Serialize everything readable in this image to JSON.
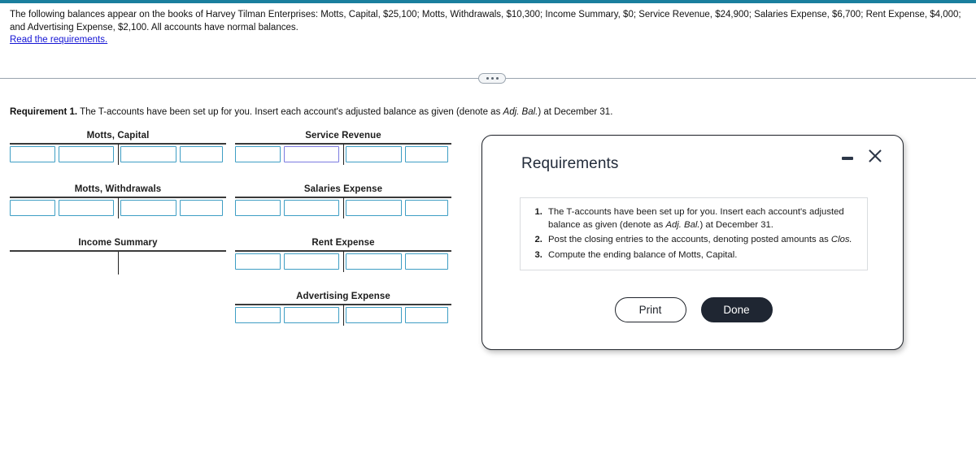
{
  "top_bar": {
    "accent_color": "#1a7f9e"
  },
  "problem": {
    "text": "The following balances appear on the books of Harvey Tilman Enterprises: Motts, Capital, $25,100; Motts, Withdrawals, $10,300; Income Summary, $0; Service Revenue, $24,900; Salaries Expense, $6,700; Rent Expense, $4,000; and Advertising Expense, $2,100. All accounts have normal balances.",
    "link_label": "Read the requirements."
  },
  "requirement": {
    "label": "Requirement 1.",
    "text_before_italic": " The T-accounts have been set up for you. Insert each account's adjusted balance as given (denote as ",
    "italic": "Adj. Bal.",
    "text_after_italic": ") at December 31."
  },
  "taccounts": {
    "left": [
      {
        "title": "Motts, Capital",
        "has_inputs": true
      },
      {
        "title": "Motts, Withdrawals",
        "has_inputs": true
      },
      {
        "title": "Income Summary",
        "has_inputs": false
      }
    ],
    "right": [
      {
        "title": "Service Revenue",
        "has_inputs": true,
        "focused_cell": 1
      },
      {
        "title": "Salaries Expense",
        "has_inputs": true
      },
      {
        "title": "Rent Expense",
        "has_inputs": true
      },
      {
        "title": "Advertising Expense",
        "has_inputs": true
      }
    ],
    "cell_value": "",
    "border_color": "#3e9ec4",
    "focus_border_color": "#7b7be0"
  },
  "modal": {
    "title": "Requirements",
    "minimize_icon": "minimize-icon",
    "close_icon": "close-icon",
    "items": [
      {
        "before": "The T-accounts have been set up for you. Insert each account's adjusted balance as given (denote as ",
        "italic": "Adj. Bal.",
        "after": ") at December 31."
      },
      {
        "before": "Post the closing entries to the accounts, denoting posted amounts as ",
        "italic": "Clos.",
        "after": ""
      },
      {
        "before": "Compute the ending balance of Motts, Capital.",
        "italic": "",
        "after": ""
      }
    ],
    "print_label": "Print",
    "done_label": "Done",
    "done_color": "#1f2632"
  }
}
